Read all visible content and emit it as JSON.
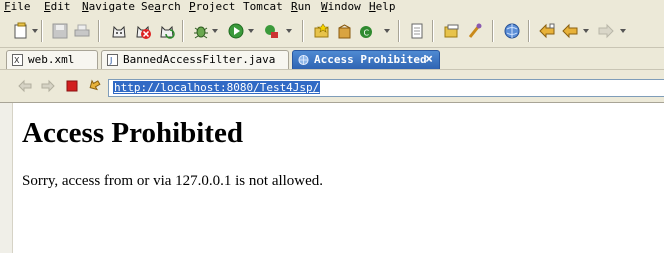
{
  "menu": [
    {
      "label": "File",
      "accel": "F"
    },
    {
      "label": "Edit",
      "accel": "E"
    },
    {
      "label": "Navigate",
      "accel": "N"
    },
    {
      "label": "Search",
      "accel": "a"
    },
    {
      "label": "Project",
      "accel": "P"
    },
    {
      "label": "Tomcat",
      "accel": ""
    },
    {
      "label": "Run",
      "accel": "R"
    },
    {
      "label": "Window",
      "accel": "W"
    },
    {
      "label": "Help",
      "accel": "H"
    }
  ],
  "toolbar": {
    "icons": [
      "new-icon",
      "save-icon",
      "print-icon",
      "tomcat-start-icon",
      "tomcat-stop-icon",
      "tomcat-restart-icon",
      "debug-icon",
      "run-icon",
      "external-tools-icon",
      "new-java-project-icon",
      "new-package-icon",
      "new-class-icon",
      "open-type-icon",
      "open-resource-icon",
      "search-icon",
      "web-browser-icon",
      "last-edit-icon",
      "back-icon",
      "forward-icon"
    ]
  },
  "tabs": [
    {
      "label": "web.xml",
      "icon": "xml-file-icon",
      "active": false
    },
    {
      "label": "BannedAccessFilter.java",
      "icon": "java-file-icon",
      "active": false
    },
    {
      "label": "Access Prohibited",
      "icon": "globe-icon",
      "active": true
    }
  ],
  "browser": {
    "url": "http://localhost:8080/Test4Jsp/",
    "nav_icons": [
      "back-icon",
      "forward-icon",
      "stop-icon",
      "refresh-icon"
    ]
  },
  "page": {
    "title": "Access Prohibited",
    "message": "Sorry, access from or via 127.0.0.1 is not allowed."
  },
  "colors": {
    "chrome": "#ece9d8",
    "active_tab": "#3a70c0",
    "url_selection": "#316ac5"
  }
}
